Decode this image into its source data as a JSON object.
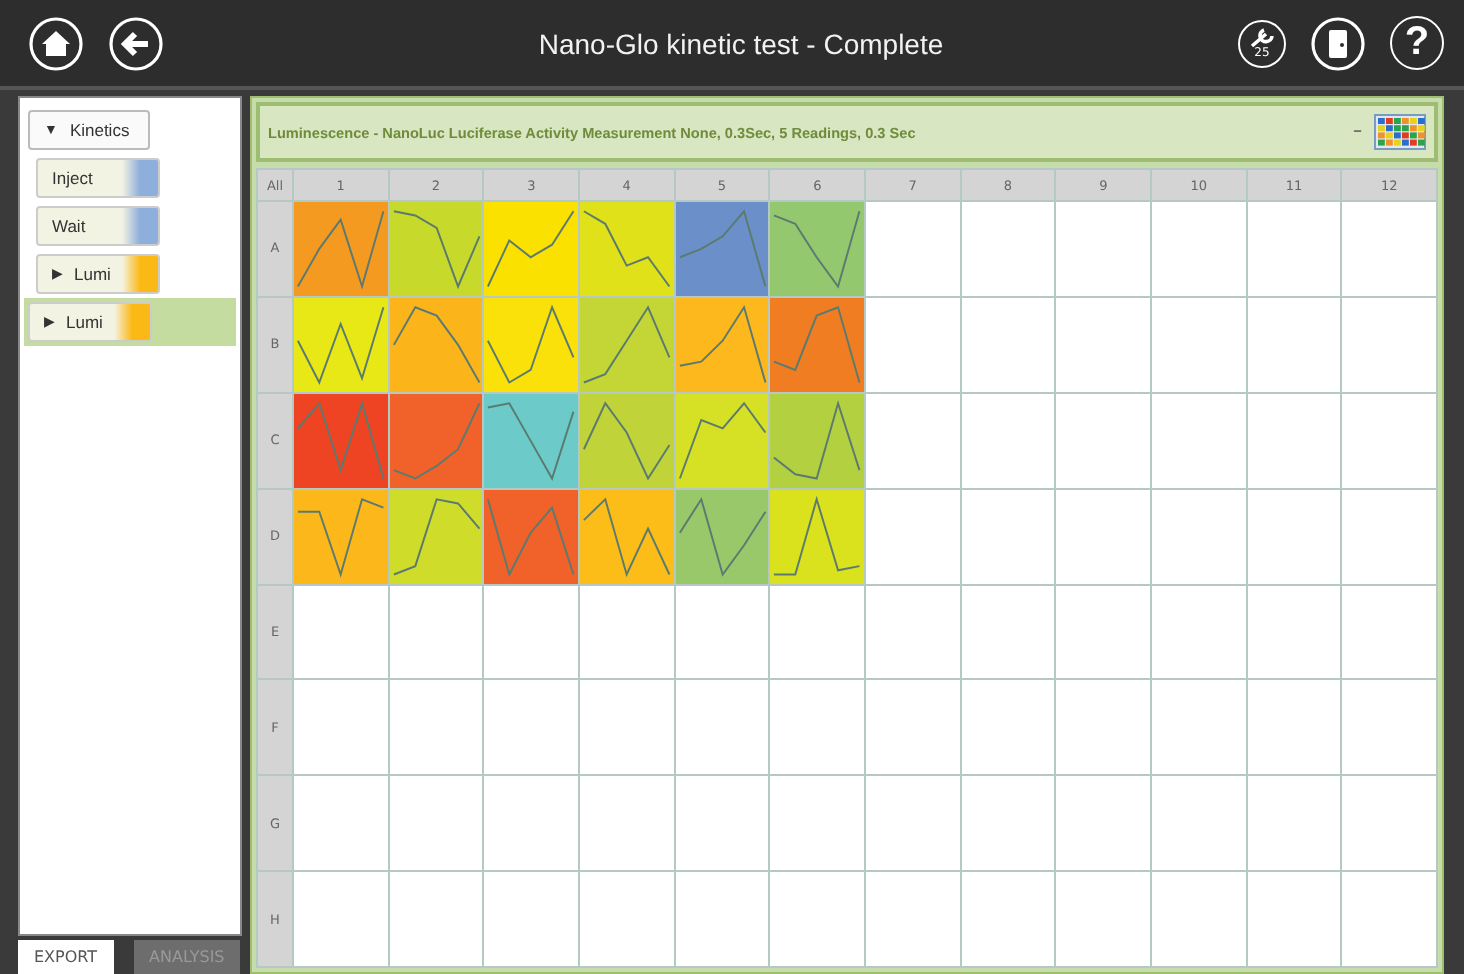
{
  "window": {
    "title": "Nano-Glo kinetic test - Complete"
  },
  "toolbar": {
    "tools_badge": "25",
    "help": "?"
  },
  "protocol": {
    "label": "Kinetics",
    "glyph": "▼",
    "expanded": true,
    "children": [
      {
        "label": "Inject",
        "color": "#8eaedb",
        "selected": false
      },
      {
        "label": "Wait",
        "color": "#8eaedb",
        "selected": false
      },
      {
        "label": "Lumi",
        "glyph": "▶",
        "color": "#fbb916",
        "selected": false
      },
      {
        "label": "Lumi",
        "glyph": "▶",
        "color": "#fbb916",
        "selected": true
      }
    ]
  },
  "tabs": [
    {
      "label": "EXPORT",
      "selected": true
    },
    {
      "label": "ANALYSIS",
      "selected": false
    }
  ],
  "measurement": {
    "title": "Luminescence - NanoLuc Luciferase Activity Measurement None, 0.3Sec, 5 Readings, 0.3 Sec",
    "minimize": "–"
  },
  "plate": {
    "corner": "All",
    "columns": [
      "1",
      "2",
      "3",
      "4",
      "5",
      "6",
      "7",
      "8",
      "9",
      "10",
      "11",
      "12"
    ],
    "rows": [
      {
        "label": "A",
        "wells": [
          {
            "color": "#f59a20"
          },
          {
            "color": "#c7d92a"
          },
          {
            "color": "#fae100"
          },
          {
            "color": "#e0e118"
          },
          {
            "color": "#6b8fc8"
          },
          {
            "color": "#94c86e"
          }
        ]
      },
      {
        "label": "B",
        "wells": [
          {
            "color": "#e8e817"
          },
          {
            "color": "#fbb41a"
          },
          {
            "color": "#fae10a"
          },
          {
            "color": "#c4d635"
          },
          {
            "color": "#fcb81c"
          },
          {
            "color": "#f07d22"
          }
        ]
      },
      {
        "label": "C",
        "wells": [
          {
            "color": "#ee4423"
          },
          {
            "color": "#f0622a"
          },
          {
            "color": "#6ccac8"
          },
          {
            "color": "#c0d43a"
          },
          {
            "color": "#d6e024"
          },
          {
            "color": "#b2d040"
          }
        ]
      },
      {
        "label": "D",
        "wells": [
          {
            "color": "#fcb81a"
          },
          {
            "color": "#d0dc2a"
          },
          {
            "color": "#f0622a"
          },
          {
            "color": "#fcbd18"
          },
          {
            "color": "#98c86a"
          },
          {
            "color": "#dae21e"
          }
        ]
      },
      {
        "label": "E",
        "wells": []
      },
      {
        "label": "F",
        "wells": []
      },
      {
        "label": "G",
        "wells": []
      },
      {
        "label": "H",
        "wells": []
      }
    ]
  }
}
